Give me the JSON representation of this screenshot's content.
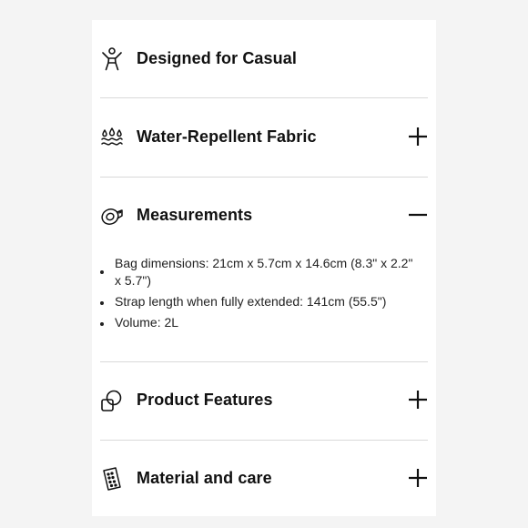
{
  "sections": [
    {
      "title": "Designed for Casual",
      "icon": "person-arms-up-icon",
      "toggle": "none"
    },
    {
      "title": "Water-Repellent Fabric",
      "icon": "water-drops-icon",
      "toggle": "plus-icon"
    },
    {
      "title": "Measurements",
      "icon": "measuring-tape-icon",
      "toggle": "minus-icon"
    },
    {
      "title": "Product Features",
      "icon": "overlapping-shapes-icon",
      "toggle": "plus-icon"
    },
    {
      "title": "Material and care",
      "icon": "fabric-swatch-icon",
      "toggle": "plus-icon"
    }
  ],
  "measurements": {
    "items": [
      "Bag dimensions: 21cm x 5.7cm x 14.6cm (8.3\" x 2.2\" x 5.7\")",
      "Strap length when fully extended: 141cm (55.5\")",
      "Volume: 2L"
    ]
  },
  "colors": {
    "background": "#f4f4f4",
    "card": "#ffffff",
    "text": "#111111",
    "divider": "#d9d9d9"
  }
}
